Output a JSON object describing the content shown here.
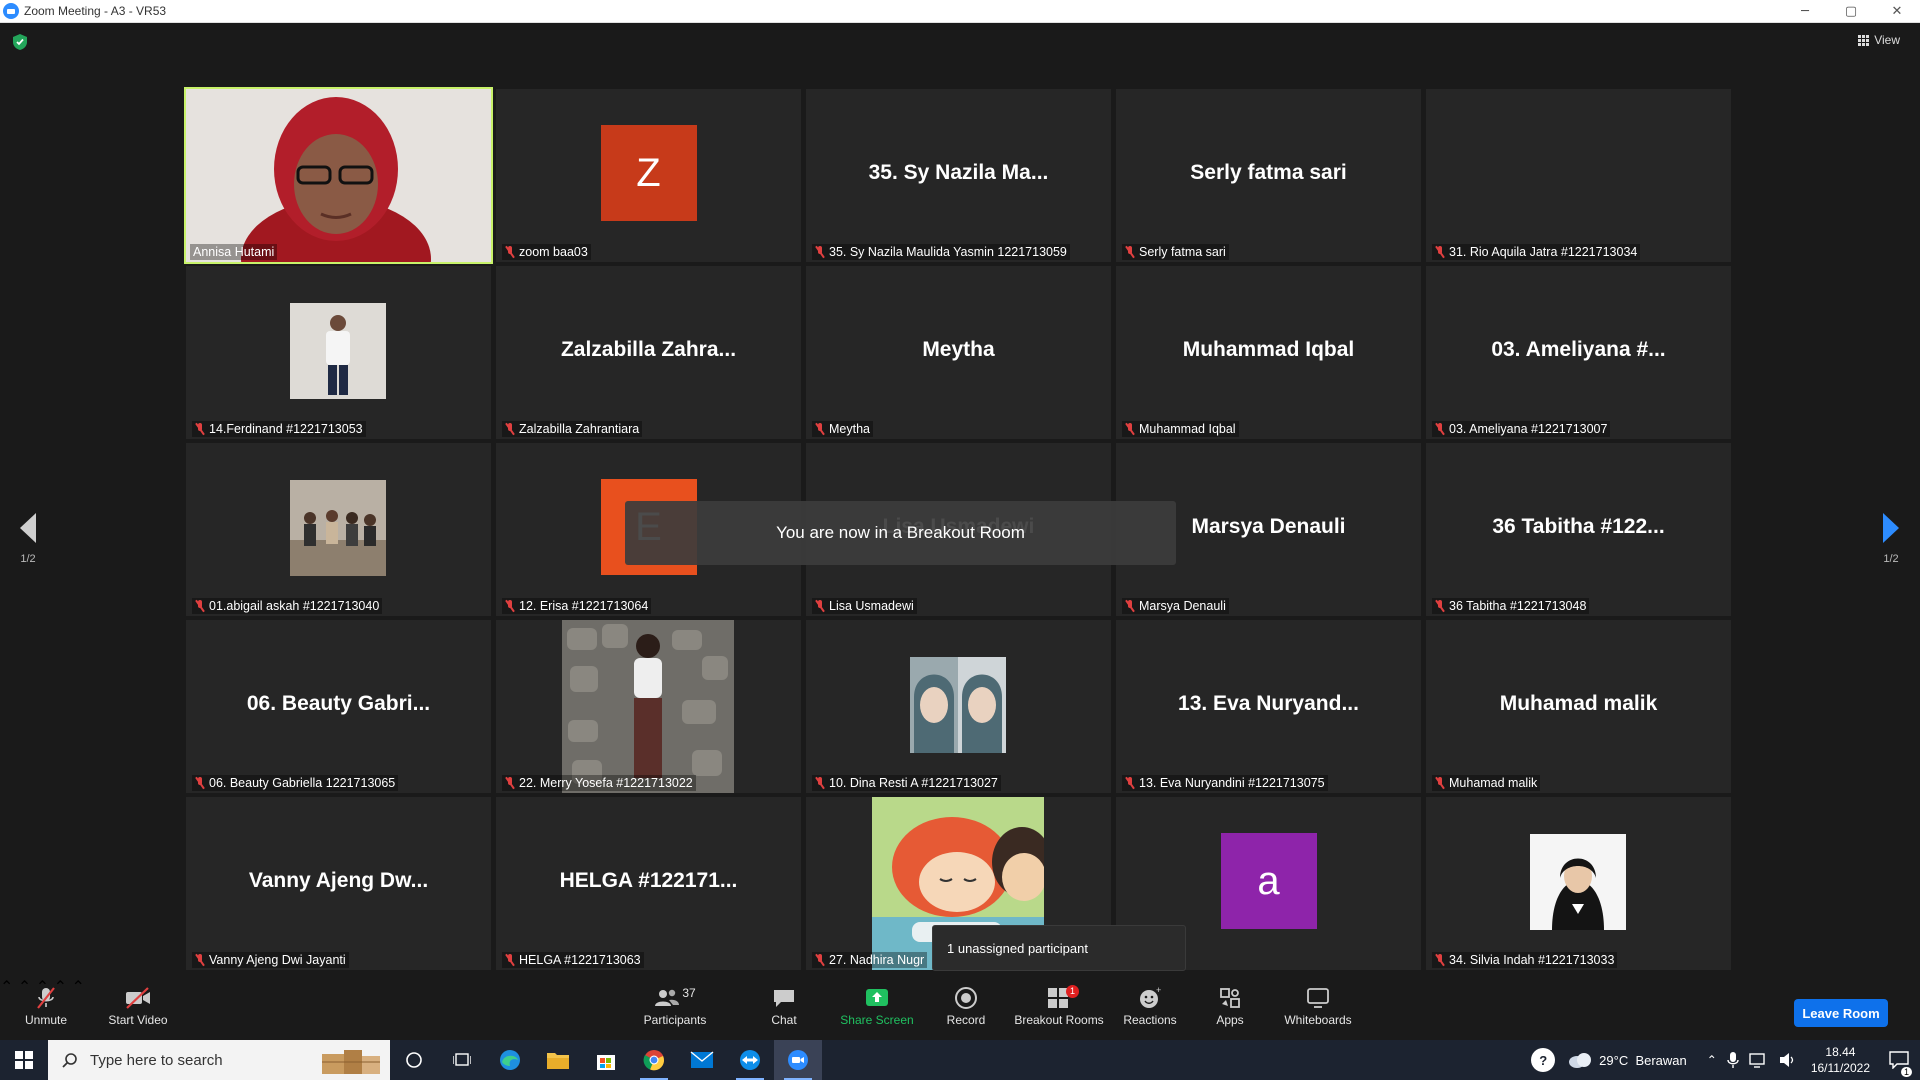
{
  "window": {
    "title": "Zoom Meeting - A3 - VR53",
    "controls": [
      "─",
      "▢",
      "✕"
    ]
  },
  "meeting": {
    "view_label": "View",
    "page_indicator_left": "1/2",
    "page_indicator_right": "1/2",
    "toast": "You are now in a Breakout Room",
    "tooltip": "1 unassigned participant",
    "tiles": [
      {
        "label": "Annisa Hutami",
        "big": "",
        "kind": "video"
      },
      {
        "label": "zoom baa03",
        "big": "",
        "kind": "avatar",
        "letter": "Z",
        "color": "#c73a1a"
      },
      {
        "label": "35. Sy Nazila Maulida Yasmin 1221713059",
        "big": "35. Sy Nazila Ma...",
        "kind": "name"
      },
      {
        "label": "Serly fatma sari",
        "big": "Serly fatma sari",
        "kind": "name"
      },
      {
        "label": "31. Rio Aquila Jatra #1221713034",
        "big": "",
        "kind": "blank"
      },
      {
        "label": "14.Ferdinand #1221713053",
        "big": "",
        "kind": "photo-person"
      },
      {
        "label": "Zalzabilla Zahrantiara",
        "big": "Zalzabilla  Zahra...",
        "kind": "name"
      },
      {
        "label": "Meytha",
        "big": "Meytha",
        "kind": "name"
      },
      {
        "label": "Muhammad Iqbal",
        "big": "Muhammad Iqbal",
        "kind": "name"
      },
      {
        "label": "03. Ameliyana #1221713007",
        "big": "03. Ameliyana #...",
        "kind": "name"
      },
      {
        "label": "01.abigail askah #1221713040",
        "big": "",
        "kind": "photo-group"
      },
      {
        "label": "12. Erisa #1221713064",
        "big": "",
        "kind": "avatar",
        "letter": "E",
        "color": "#e8501e"
      },
      {
        "label": "Lisa Usmadewi",
        "big": "Lisa Usmadewi",
        "kind": "name-hidden"
      },
      {
        "label": "Marsya Denauli",
        "big": "Marsya Denauli",
        "kind": "name"
      },
      {
        "label": "36 Tabitha #1221713048",
        "big": "36 Tabitha #122...",
        "kind": "name"
      },
      {
        "label": "06. Beauty Gabriella 1221713065",
        "big": "06. Beauty Gabri...",
        "kind": "name"
      },
      {
        "label": "22. Merry Yosefa #1221713022",
        "big": "",
        "kind": "photo-wall"
      },
      {
        "label": "10. Dina Resti A #1221713027",
        "big": "",
        "kind": "photo-pair"
      },
      {
        "label": "13. Eva Nuryandini #1221713075",
        "big": "13. Eva Nuryand...",
        "kind": "name"
      },
      {
        "label": "Muhamad malik",
        "big": "Muhamad malik",
        "kind": "name"
      },
      {
        "label": "Vanny Ajeng Dwi Jayanti",
        "big": "Vanny Ajeng Dw...",
        "kind": "name"
      },
      {
        "label": "HELGA #1221713063",
        "big": "HELGA #122171...",
        "kind": "name"
      },
      {
        "label": "27. Nadhira Nugr",
        "big": "",
        "kind": "photo-anime"
      },
      {
        "label": "",
        "big": "",
        "kind": "avatar",
        "letter": "a",
        "color": "#8e24aa"
      },
      {
        "label": "34. Silvia Indah #1221713033",
        "big": "",
        "kind": "photo-portrait"
      }
    ]
  },
  "toolbar": {
    "unmute": "Unmute",
    "start_video": "Start Video",
    "participants": "Participants",
    "participants_count": "37",
    "chat": "Chat",
    "share_screen": "Share Screen",
    "record": "Record",
    "breakout_rooms": "Breakout Rooms",
    "breakout_badge": "1",
    "reactions": "Reactions",
    "apps": "Apps",
    "whiteboards": "Whiteboards",
    "leave": "Leave Room"
  },
  "taskbar": {
    "search_placeholder": "Type here to search",
    "weather": "29°C  Berawan",
    "time": "18.44",
    "date": "16/11/2022",
    "notif_count": "1"
  },
  "colors": {
    "accent": "#2d8cff",
    "active_border": "#c8f26a",
    "leave": "#0e71eb",
    "muted": "#e04040"
  }
}
